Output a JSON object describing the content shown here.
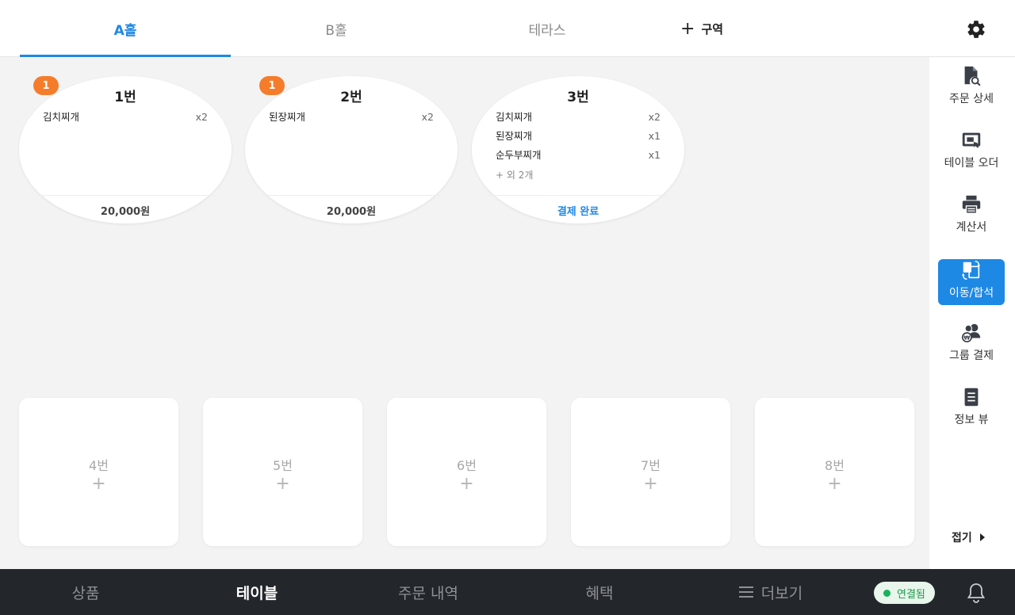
{
  "zones": {
    "tabs": [
      {
        "label": "A홀"
      },
      {
        "label": "B홀"
      },
      {
        "label": "테라스"
      }
    ],
    "add_label": "구역"
  },
  "occupied_tables": [
    {
      "badge": "1",
      "name": "1번",
      "items": [
        {
          "name": "김치찌개",
          "qty": "x2"
        }
      ],
      "more": "",
      "footer": "20,000원"
    },
    {
      "badge": "1",
      "name": "2번",
      "items": [
        {
          "name": "된장찌개",
          "qty": "x2"
        }
      ],
      "more": "",
      "footer": "20,000원"
    },
    {
      "badge": "",
      "name": "3번",
      "items": [
        {
          "name": "김치찌개",
          "qty": "x2"
        },
        {
          "name": "된장찌개",
          "qty": "x1"
        },
        {
          "name": "순두부찌개",
          "qty": "x1"
        }
      ],
      "more": "+ 외 2개",
      "footer": "결제 완료"
    }
  ],
  "empty_tables": [
    {
      "name": "4번",
      "plus": "+"
    },
    {
      "name": "5번",
      "plus": "+"
    },
    {
      "name": "6번",
      "plus": "+"
    },
    {
      "name": "7번",
      "plus": "+"
    },
    {
      "name": "8번",
      "plus": "+"
    }
  ],
  "side_panel": {
    "items": [
      {
        "label": "주문 상세",
        "icon": "document-search-icon"
      },
      {
        "label": "테이블 오더",
        "icon": "tablet-order-icon"
      },
      {
        "label": "계산서",
        "icon": "printer-icon"
      },
      {
        "label": "이동/합석",
        "icon": "move-merge-icon"
      },
      {
        "label": "그룹 결제",
        "icon": "group-payment-icon"
      },
      {
        "label": "정보 뷰",
        "icon": "info-view-icon"
      }
    ],
    "collapse_label": "접기"
  },
  "bottom_nav": {
    "items": [
      {
        "label": "상품"
      },
      {
        "label": "테이블"
      },
      {
        "label": "주문 내역"
      },
      {
        "label": "혜택"
      },
      {
        "label": "더보기"
      }
    ],
    "connection": "연결됨"
  },
  "colors": {
    "accent": "#1e88e5",
    "badge": "#f57c2b",
    "nav_bg": "#23262b",
    "connected": "#16b35a"
  }
}
